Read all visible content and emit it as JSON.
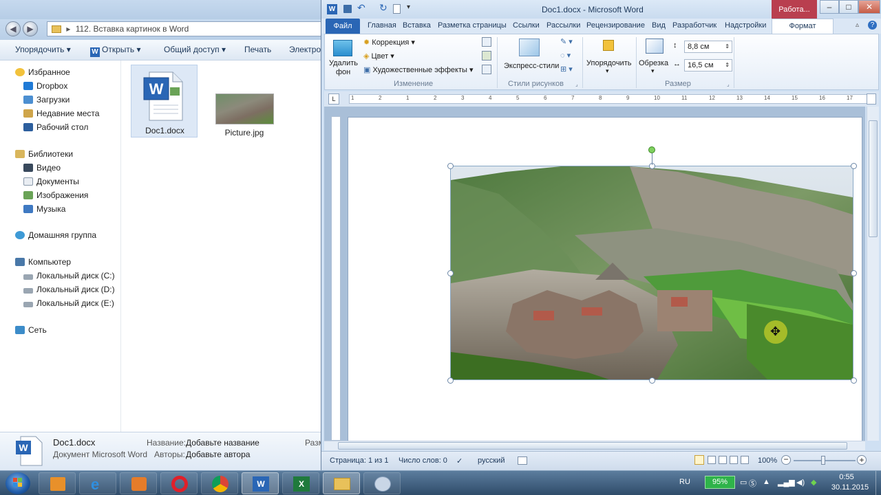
{
  "explorer": {
    "address": "112. Вставка картинок в Word",
    "toolbar": {
      "organize": "Упорядочить",
      "open": "Открыть",
      "share": "Общий доступ",
      "print": "Печать",
      "email": "Электрон"
    },
    "nav": {
      "favorites": "Избранное",
      "favorites_items": [
        "Dropbox",
        "Загрузки",
        "Недавние места",
        "Рабочий стол"
      ],
      "libraries": "Библиотеки",
      "libraries_items": [
        "Видео",
        "Документы",
        "Изображения",
        "Музыка"
      ],
      "homegroup": "Домашняя группа",
      "computer": "Компьютер",
      "computer_items": [
        "Локальный диск (C:)",
        "Локальный диск (D:)",
        "Локальный диск (E:)"
      ],
      "network": "Сеть"
    },
    "files": [
      {
        "name": "Doc1.docx"
      },
      {
        "name": "Picture.jpg"
      }
    ],
    "details": {
      "filename": "Doc1.docx",
      "filetype": "Документ Microsoft Word",
      "title_label": "Название:",
      "title_value": "Добавьте название",
      "authors_label": "Авторы:",
      "authors_value": "Добавьте автора",
      "size_label": "Разм"
    }
  },
  "word": {
    "title": "Doc1.docx - Microsoft Word",
    "context_tab": "Работа...",
    "tabs": {
      "file": "Файл",
      "home": "Главная",
      "insert": "Вставка",
      "layout": "Разметка страницы",
      "refs": "Ссылки",
      "mailings": "Рассылки",
      "review": "Рецензирование",
      "view": "Вид",
      "developer": "Разработчик",
      "addins": "Надстройки",
      "format": "Формат"
    },
    "ribbon": {
      "remove_bg_1": "Удалить",
      "remove_bg_2": "фон",
      "correction": "Коррекция",
      "color": "Цвет",
      "artistic": "Художественные эффекты",
      "group_adjust": "Изменение",
      "quick_styles": "Экспресс-стили",
      "group_styles": "Стили рисунков",
      "arrange": "Упорядочить",
      "crop": "Обрезка",
      "height": "8,8 см",
      "width": "16,5 см",
      "group_size": "Размер"
    },
    "status": {
      "page": "Страница: 1 из 1",
      "words": "Число слов: 0",
      "lang": "русский",
      "zoom": "100%"
    },
    "ruler_marks": [
      "1",
      "2",
      "1",
      "2",
      "3",
      "4",
      "5",
      "6",
      "7",
      "8",
      "9",
      "10",
      "11",
      "12",
      "13",
      "14",
      "15",
      "16",
      "17"
    ]
  },
  "taskbar": {
    "lang": "RU",
    "battery": "95%",
    "time": "0:55",
    "date": "30.11.2015"
  },
  "colors": {
    "word_blue": "#2a66b5",
    "context_red": "#b93f4f",
    "battery_green": "#2fb34a"
  }
}
